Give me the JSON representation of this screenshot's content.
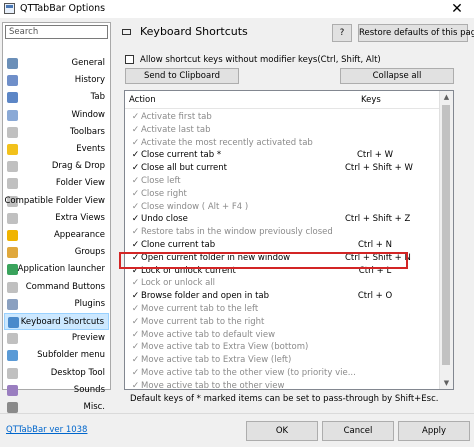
{
  "window": {
    "title": "QTTabBar Options"
  },
  "sidebar": {
    "search_placeholder": "Search",
    "items": [
      {
        "label": "General",
        "icon": "gear-icon",
        "color": "#6b8fb8"
      },
      {
        "label": "History",
        "icon": "history-icon",
        "color": "#6f8fc9"
      },
      {
        "label": "Tab",
        "icon": "tab-icon",
        "color": "#5c86c6"
      },
      {
        "label": "Window",
        "icon": "window-icon",
        "color": "#8aa9d6"
      },
      {
        "label": "Toolbars",
        "icon": "toolbar-icon",
        "color": "#c0c0c0"
      },
      {
        "label": "Events",
        "icon": "lightning-icon",
        "color": "#f2c11b"
      },
      {
        "label": "Drag & Drop",
        "icon": "drag-drop-icon",
        "color": "#c0c0c0"
      },
      {
        "label": "Folder View",
        "icon": "folder-view-icon",
        "color": "#c0c0c0"
      },
      {
        "label": "Compatible Folder View",
        "icon": "compatible-folder-view-icon",
        "color": "#c0c0c0"
      },
      {
        "label": "Extra Views",
        "icon": "extra-views-icon",
        "color": "#c0c0c0"
      },
      {
        "label": "Appearance",
        "icon": "star-icon",
        "color": "#f0b400"
      },
      {
        "label": "Groups",
        "icon": "groups-icon",
        "color": "#e0a83c"
      },
      {
        "label": "Application launcher",
        "icon": "app-launcher-icon",
        "color": "#3aa35c"
      },
      {
        "label": "Command Buttons",
        "icon": "command-buttons-icon",
        "color": "#c0c0c0"
      },
      {
        "label": "Plugins",
        "icon": "plugin-icon",
        "color": "#8aa0c0"
      },
      {
        "label": "Keyboard Shortcuts",
        "icon": "keyboard-icon",
        "color": "#4a8acb"
      },
      {
        "label": "Preview",
        "icon": "preview-icon",
        "color": "#c0c0c0"
      },
      {
        "label": "Subfolder menu",
        "icon": "subfolder-menu-icon",
        "color": "#5a9ad6"
      },
      {
        "label": "Desktop Tool",
        "icon": "desktop-tool-icon",
        "color": "#c0c0c0"
      },
      {
        "label": "Sounds",
        "icon": "sound-icon",
        "color": "#9a7ec0"
      },
      {
        "label": "Misc.",
        "icon": "misc-icon",
        "color": "#8a8a8a"
      }
    ]
  },
  "panel": {
    "title": "Keyboard Shortcuts",
    "help_label": "?",
    "restore_label": "Restore defaults of this page",
    "allow_checkbox_label": "Allow shortcut keys without modifier keys(Ctrl, Shift, Alt)",
    "send_label": "Send to Clipboard",
    "collapse_label": "Collapse all",
    "columns": {
      "action": "Action",
      "keys": "Keys"
    },
    "rows": [
      {
        "action": "Activate first tab",
        "keys": "",
        "checked": false,
        "disabled": true
      },
      {
        "action": "Activate last tab",
        "keys": "",
        "checked": false,
        "disabled": true
      },
      {
        "action": "Activate the most recently activated tab",
        "keys": "",
        "checked": false,
        "disabled": true
      },
      {
        "action": "Close current tab *",
        "keys": "Ctrl + W",
        "checked": true,
        "disabled": false
      },
      {
        "action": "Close all but current",
        "keys": "Ctrl + Shift + W",
        "checked": true,
        "disabled": false
      },
      {
        "action": "Close left",
        "keys": "",
        "checked": false,
        "disabled": true
      },
      {
        "action": "Close right",
        "keys": "",
        "checked": false,
        "disabled": true
      },
      {
        "action": "Close window ( Alt + F4 )",
        "keys": "",
        "checked": false,
        "disabled": true
      },
      {
        "action": "Undo close",
        "keys": "Ctrl + Shift + Z",
        "checked": true,
        "disabled": false
      },
      {
        "action": "Restore tabs in the window previously closed",
        "keys": "",
        "checked": false,
        "disabled": true
      },
      {
        "action": "Clone current tab",
        "keys": "Ctrl + N",
        "checked": true,
        "disabled": false
      },
      {
        "action": "Open current folder in new window",
        "keys": "Ctrl + Shift + N",
        "checked": true,
        "disabled": false
      },
      {
        "action": "Lock or unlock current",
        "keys": "Ctrl + L",
        "checked": true,
        "disabled": false
      },
      {
        "action": "Lock or unlock all",
        "keys": "",
        "checked": false,
        "disabled": true
      },
      {
        "action": "Browse folder and open in tab",
        "keys": "Ctrl + O",
        "checked": true,
        "disabled": false
      },
      {
        "action": "Move current tab to the left",
        "keys": "",
        "checked": false,
        "disabled": true
      },
      {
        "action": "Move current tab to the right",
        "keys": "",
        "checked": false,
        "disabled": true
      },
      {
        "action": "Move active tab to default view",
        "keys": "",
        "checked": false,
        "disabled": true
      },
      {
        "action": "Move active tab to Extra View (bottom)",
        "keys": "",
        "checked": false,
        "disabled": true
      },
      {
        "action": "Move active tab to Extra View (left)",
        "keys": "",
        "checked": false,
        "disabled": true
      },
      {
        "action": "Move active tab to the other view (to priority vie...",
        "keys": "",
        "checked": false,
        "disabled": true
      },
      {
        "action": "Move active tab to the other view",
        "keys": "",
        "checked": false,
        "disabled": true
      }
    ],
    "footnote": "Default keys of * marked items can be set to pass-through by Shift+Esc."
  },
  "footer": {
    "version": "QTTabBar ver 1038",
    "ok_label": "OK",
    "cancel_label": "Cancel",
    "apply_label": "Apply"
  },
  "colors": {
    "highlight_border": "#d32525",
    "selected_bg": "#cce8ff",
    "link": "#0066cc"
  }
}
